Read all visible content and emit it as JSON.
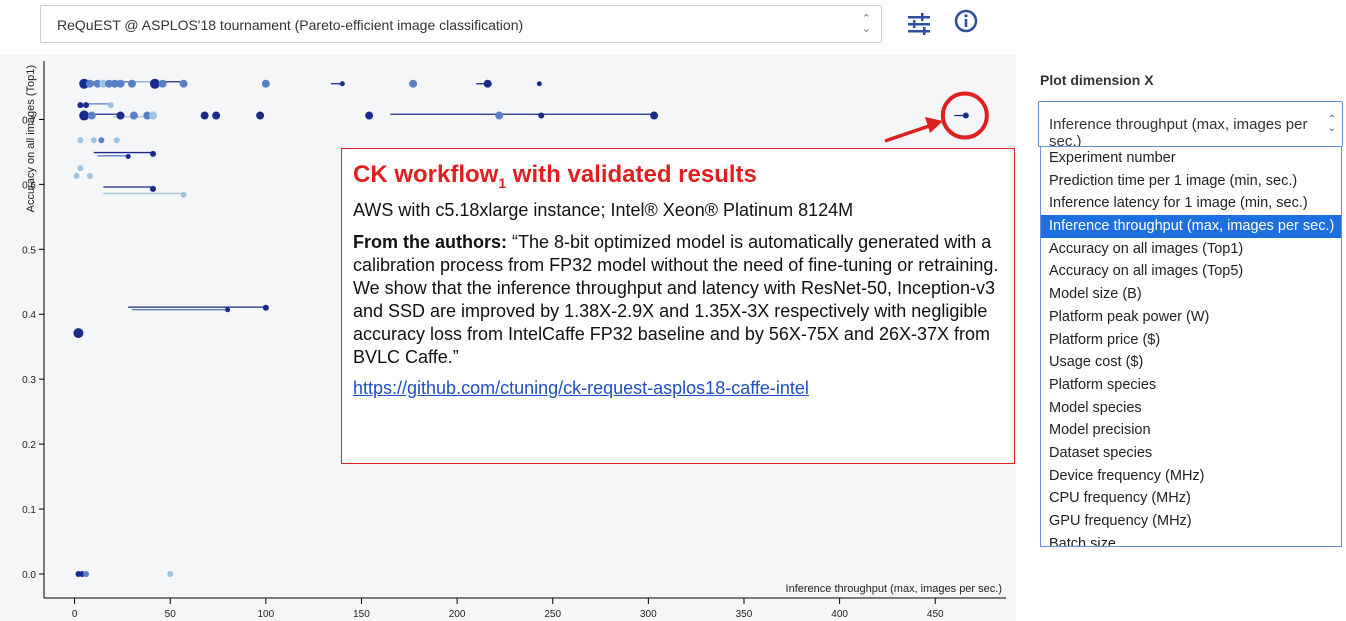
{
  "top_select": {
    "value": "ReQuEST @ ASPLOS'18 tournament (Pareto-efficient image classification)"
  },
  "icons": {
    "settings": "sliders-icon",
    "info": "info-icon"
  },
  "callout": {
    "title_main": "CK workflow",
    "title_sub": "1",
    "title_rest": " with validated results",
    "platform": "AWS with c5.18xlarge instance; Intel® Xeon® Platinum 8124M",
    "authors_label": "From the authors:",
    "authors_text": " “The 8-bit optimized model is automatically generated with a calibration process from FP32 model without the need of fine-tuning or retraining. We show that the inference throughput and latency with ResNet-50, Inception-v3 and SSD are improved by 1.38X-2.9X and 1.35X-3X respectively with negligible accuracy loss from IntelCaffe FP32 baseline and by 56X-75X and 26X-37X from BVLC Caffe.”",
    "link": "https://github.com/ctuning/ck-request-asplos18-caffe-intel"
  },
  "plot_dimension": {
    "title": "Plot dimension X",
    "selected": "Inference throughput (max, images per sec.)",
    "options": [
      "Experiment number",
      "Prediction time per 1 image (min, sec.)",
      "Inference latency for 1 image (min, sec.)",
      "Inference throughput (max, images per sec.)",
      "Accuracy on all images (Top1)",
      "Accuracy on all images (Top5)",
      "Model size (B)",
      "Platform peak power (W)",
      "Platform price ($)",
      "Usage cost ($)",
      "Platform species",
      "Model species",
      "Model precision",
      "Dataset species",
      "Device frequency (MHz)",
      "CPU frequency (MHz)",
      "GPU frequency (MHz)",
      "Batch size"
    ]
  },
  "colors": {
    "dark": "#1a2b8c",
    "mid": "#5b7fc6",
    "light": "#9ec4e0",
    "red": "#e02020",
    "select": "#1e6fe0"
  },
  "chart_data": {
    "type": "scatter",
    "xlabel": "Inference throughput (max, images per sec.)",
    "ylabel": "Accuracy on all images (Top1)",
    "xlim": [
      -16,
      487
    ],
    "ylim": [
      -0.037,
      0.79
    ],
    "xticks": [
      0,
      50,
      100,
      150,
      200,
      250,
      300,
      350,
      400,
      450
    ],
    "yticks": [
      0.0,
      0.1,
      0.2,
      0.3,
      0.4,
      0.5,
      0.6,
      0.7
    ],
    "points": [
      {
        "x": 5,
        "y": 0.755,
        "c": "dark",
        "r": 5
      },
      {
        "x": 8,
        "y": 0.755,
        "c": "mid",
        "r": 4
      },
      {
        "x": 12,
        "y": 0.755,
        "c": "mid",
        "r": 4
      },
      {
        "x": 15,
        "y": 0.755,
        "c": "light",
        "r": 4
      },
      {
        "x": 18,
        "y": 0.755,
        "c": "mid",
        "r": 4
      },
      {
        "x": 21,
        "y": 0.755,
        "c": "mid",
        "r": 4
      },
      {
        "x": 24,
        "y": 0.755,
        "c": "mid",
        "r": 4
      },
      {
        "x": 30,
        "y": 0.755,
        "c": "mid",
        "r": 4
      },
      {
        "x": 42,
        "y": 0.755,
        "c": "dark",
        "r": 5
      },
      {
        "x": 46,
        "y": 0.755,
        "c": "mid",
        "r": 4
      },
      {
        "x": 57,
        "y": 0.755,
        "c": "mid",
        "r": 4
      },
      {
        "x": 100,
        "y": 0.755,
        "c": "mid",
        "r": 4
      },
      {
        "x": 140,
        "y": 0.755,
        "c": "dark",
        "r": 2.5
      },
      {
        "x": 177,
        "y": 0.755,
        "c": "mid",
        "r": 4
      },
      {
        "x": 216,
        "y": 0.755,
        "c": "dark",
        "r": 4
      },
      {
        "x": 243,
        "y": 0.755,
        "c": "dark",
        "r": 2.5
      },
      {
        "x": 3,
        "y": 0.722,
        "c": "dark",
        "r": 3
      },
      {
        "x": 6,
        "y": 0.722,
        "c": "dark",
        "r": 3
      },
      {
        "x": 19,
        "y": 0.722,
        "c": "light",
        "r": 3
      },
      {
        "x": 5,
        "y": 0.706,
        "c": "dark",
        "r": 5
      },
      {
        "x": 9,
        "y": 0.706,
        "c": "mid",
        "r": 4
      },
      {
        "x": 24,
        "y": 0.706,
        "c": "dark",
        "r": 4
      },
      {
        "x": 31,
        "y": 0.706,
        "c": "mid",
        "r": 4
      },
      {
        "x": 38,
        "y": 0.706,
        "c": "mid",
        "r": 4
      },
      {
        "x": 41,
        "y": 0.706,
        "c": "light",
        "r": 4
      },
      {
        "x": 68,
        "y": 0.706,
        "c": "dark",
        "r": 4
      },
      {
        "x": 74,
        "y": 0.706,
        "c": "dark",
        "r": 4
      },
      {
        "x": 97,
        "y": 0.706,
        "c": "dark",
        "r": 4
      },
      {
        "x": 154,
        "y": 0.706,
        "c": "dark",
        "r": 4
      },
      {
        "x": 222,
        "y": 0.706,
        "c": "mid",
        "r": 4
      },
      {
        "x": 244,
        "y": 0.706,
        "c": "dark",
        "r": 3
      },
      {
        "x": 303,
        "y": 0.706,
        "c": "dark",
        "r": 4
      },
      {
        "x": 466,
        "y": 0.706,
        "c": "dark",
        "r": 3
      },
      {
        "x": 3,
        "y": 0.668,
        "c": "light",
        "r": 3
      },
      {
        "x": 10,
        "y": 0.668,
        "c": "light",
        "r": 3
      },
      {
        "x": 14,
        "y": 0.668,
        "c": "mid",
        "r": 3
      },
      {
        "x": 22,
        "y": 0.668,
        "c": "light",
        "r": 3
      },
      {
        "x": 41,
        "y": 0.647,
        "c": "dark",
        "r": 3
      },
      {
        "x": 28,
        "y": 0.643,
        "c": "dark",
        "r": 2.5
      },
      {
        "x": 3,
        "y": 0.625,
        "c": "light",
        "r": 3
      },
      {
        "x": 1,
        "y": 0.613,
        "c": "light",
        "r": 3
      },
      {
        "x": 8,
        "y": 0.613,
        "c": "light",
        "r": 3
      },
      {
        "x": 41,
        "y": 0.593,
        "c": "dark",
        "r": 3
      },
      {
        "x": 57,
        "y": 0.584,
        "c": "light",
        "r": 3
      },
      {
        "x": 100,
        "y": 0.41,
        "c": "dark",
        "r": 3
      },
      {
        "x": 80,
        "y": 0.407,
        "c": "dark",
        "r": 2.5
      },
      {
        "x": 2,
        "y": 0.371,
        "c": "dark",
        "r": 5
      },
      {
        "x": 2,
        "y": 0.0,
        "c": "dark",
        "r": 3
      },
      {
        "x": 4,
        "y": 0.0,
        "c": "dark",
        "r": 3
      },
      {
        "x": 6,
        "y": 0.0,
        "c": "mid",
        "r": 3
      },
      {
        "x": 50,
        "y": 0.0,
        "c": "light",
        "r": 3
      }
    ],
    "ranges": [
      {
        "x1": 20,
        "x2": 57,
        "y": 0.758,
        "c": "dark"
      },
      {
        "x1": 4,
        "x2": 31,
        "y": 0.758,
        "c": "mid"
      },
      {
        "x1": 28,
        "x2": 46,
        "y": 0.758,
        "c": "light"
      },
      {
        "x1": 134,
        "x2": 140,
        "y": 0.755,
        "c": "dark"
      },
      {
        "x1": 210,
        "x2": 216,
        "y": 0.755,
        "c": "dark"
      },
      {
        "x1": 6,
        "x2": 19,
        "y": 0.724,
        "c": "mid"
      },
      {
        "x1": 5,
        "x2": 24,
        "y": 0.708,
        "c": "dark"
      },
      {
        "x1": 20,
        "x2": 41,
        "y": 0.704,
        "c": "light"
      },
      {
        "x1": 165,
        "x2": 303,
        "y": 0.708,
        "c": "dark"
      },
      {
        "x1": 460,
        "x2": 466,
        "y": 0.706,
        "c": "dark"
      },
      {
        "x1": 10,
        "x2": 41,
        "y": 0.649,
        "c": "dark"
      },
      {
        "x1": 12,
        "x2": 28,
        "y": 0.644,
        "c": "mid"
      },
      {
        "x1": 15,
        "x2": 41,
        "y": 0.596,
        "c": "dark"
      },
      {
        "x1": 15,
        "x2": 57,
        "y": 0.586,
        "c": "light"
      },
      {
        "x1": 28,
        "x2": 100,
        "y": 0.411,
        "c": "dark"
      },
      {
        "x1": 30,
        "x2": 80,
        "y": 0.407,
        "c": "mid"
      }
    ],
    "highlight": {
      "x": 466,
      "y": 0.706
    }
  }
}
